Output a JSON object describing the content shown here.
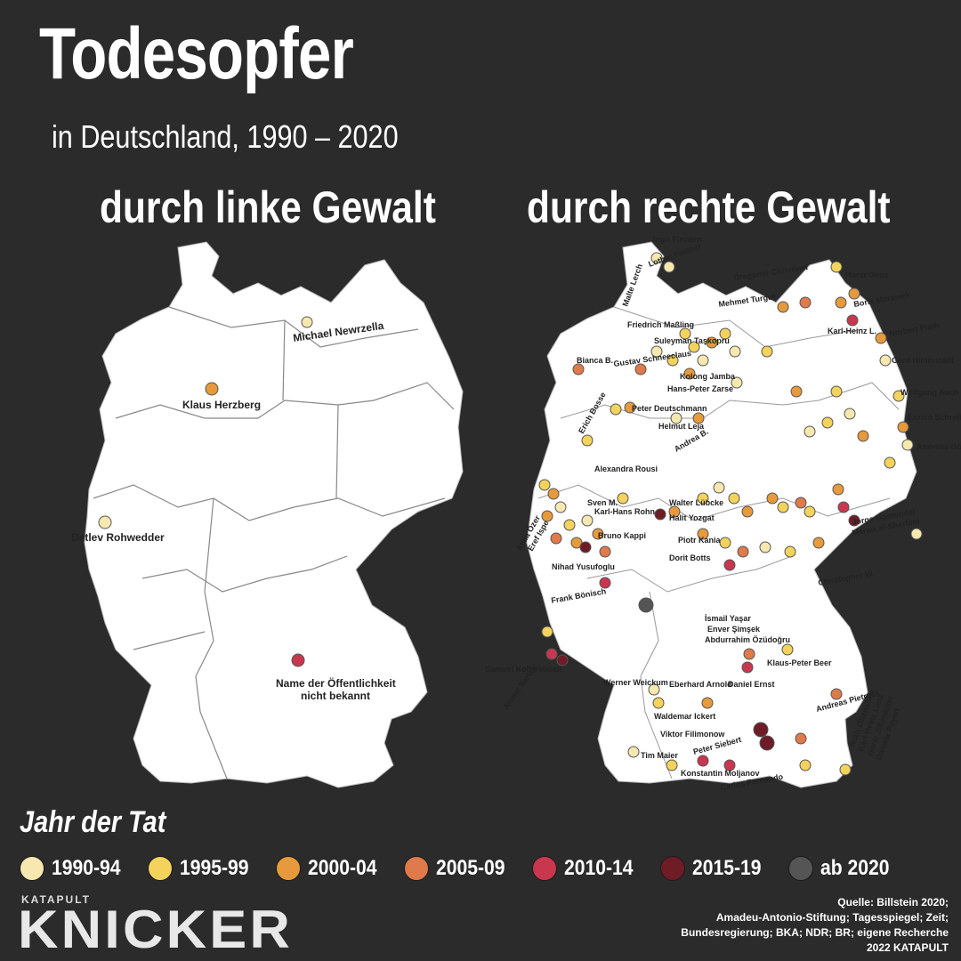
{
  "title": "Todesopfer",
  "subtitle": "in Deutschland, 1990 – 2020",
  "left_map": {
    "heading": "durch linke Gewalt",
    "victims": [
      {
        "name": "Michael Newrzella",
        "period": "1990-94"
      },
      {
        "name": "Klaus Herzberg",
        "period": "2000-04"
      },
      {
        "name": "Detlev Rohwedder",
        "period": "1990-94"
      },
      {
        "name": "Name der Öffentlichkeit nicht bekannt",
        "period": "2010-14"
      }
    ]
  },
  "right_map": {
    "heading": "durch rechte Gewalt",
    "labels": [
      "Ingo Finnern",
      "Lothar Fischer",
      "Malte Lerch",
      "Dragomir Christinel",
      "Horst Gens",
      "Mehmet Turgut",
      "Boris Morawek",
      "Friedrich Maßling",
      "Suleyman Taşkopru",
      "Karl-Heinz L.",
      "Norbert Plath",
      "Gustav Schneeclaus",
      "Bianca B.",
      "Gerd Himmstädt",
      "Kolong Jamba",
      "Hans-Peter Zarse",
      "Wolfgang Auch",
      "Peter Deutschmann",
      "Helmut Leja",
      "Erich Bosse",
      "Andrea B.",
      "Andreas Götz",
      "Alexandra Rousi",
      "Enrico Schreiber",
      "Sven M.",
      "Karl-Hans Rohn",
      "Walter Lübcke",
      "Atilla Özer",
      "Eref Ispe",
      "Halit Yozgat",
      "Bruno Kappi",
      "Piotr Kania",
      "Dorit Botts",
      "Nihad Yusufoglu",
      "Frank Bönisch",
      "Christopher W.",
      "Jorge Gomondai",
      "Marwa el-Sherbini",
      "İsmail Yaşar",
      "Enver Şimşek",
      "Abdurrahim Özüdoğru",
      "Klaus-Peter Beer",
      "Daniel Ernst",
      "Werner Weickum",
      "Eberhard Arnold",
      "Andreas Pietrzak",
      "Samuel Kofi Yeboah",
      "Ahmet Sarlak",
      "Waldemar Ickert",
      "Viktor Filimonow",
      "Tim Maier",
      "Peter Siebert",
      "Konstantin Moljanov",
      "Carlos Fernando",
      "Ruth Zillenbiller",
      "Karl-Heinz Lietz",
      "Horst Zillenbiller",
      "Daniela Peyerl"
    ]
  },
  "legend": {
    "title": "Jahr der Tat",
    "items": [
      {
        "label": "1990-94",
        "color": "#f7e8b0"
      },
      {
        "label": "1995-99",
        "color": "#f3d35c"
      },
      {
        "label": "2000-04",
        "color": "#e69a3c"
      },
      {
        "label": "2005-09",
        "color": "#e07a4a"
      },
      {
        "label": "2010-14",
        "color": "#c9374f"
      },
      {
        "label": "2015-19",
        "color": "#6e1c26"
      },
      {
        "label": "ab 2020",
        "color": "#555555"
      }
    ]
  },
  "brand": {
    "small": "KATAPULT",
    "big": "KNICKER"
  },
  "source": {
    "line1": "Quelle: Billstein 2020;",
    "line2": "Amadeu-Antonio-Stiftung; Tagesspiegel; Zeit;",
    "line3": "Bundesregierung; BKA; NDR; BR; eigene Recherche",
    "line4": "2022 KATAPULT"
  }
}
